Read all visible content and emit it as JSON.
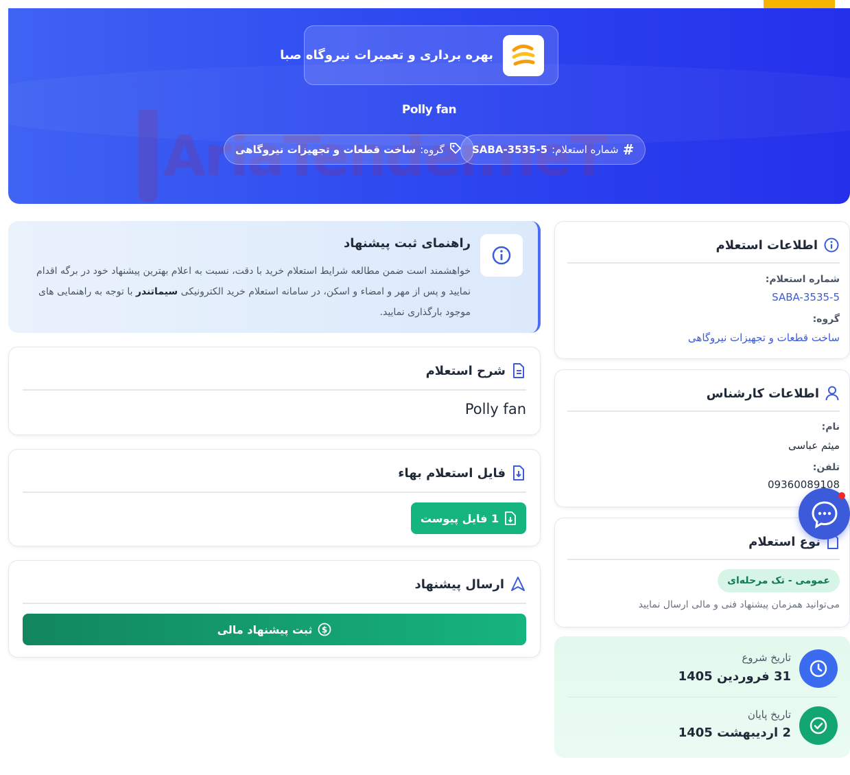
{
  "header": {
    "company_name": "بهره برداری و تعمیرات نیروگاه صبا",
    "title": "Polly fan",
    "inquiry_label": "شماره استعلام:",
    "inquiry_number": "SABA-3535-5",
    "group_label": "گروه:",
    "group_value": "ساخت قطعات و تجهیزات نیروگاهی",
    "watermark_text": "AriaTender.neT"
  },
  "guide": {
    "title": "راهنمای ثبت پیشنهاد",
    "text_part1": "خواهشمند است ضمن مطالعه شرایط استعلام خرید با دقت، نسبت به اعلام بهترین پیشنهاد خود در برگه اقدام نمایید و پس از مهر و امضاء و اسکن، در سامانه استعلام خرید الکترونیکی",
    "text_bold": "سیماتندر",
    "text_part2": "با توجه به راهنمایی های موجود بارگذاری نمایید."
  },
  "description_card": {
    "title": "شرح استعلام",
    "content": "Polly fan"
  },
  "file_card": {
    "title": "فایل استعلام بهاء",
    "button_label": "1 فایل پیوست"
  },
  "submit_card": {
    "title": "ارسال پیشنهاد",
    "button_label": "ثبت پیشنهاد مالی"
  },
  "inquiry_info": {
    "title": "اطلاعات استعلام",
    "number_label": "شماره استعلام:",
    "number_value": "SABA-3535-5",
    "group_label": "گروه:",
    "group_value": "ساخت قطعات و تجهیزات نیروگاهی"
  },
  "expert_info": {
    "title": "اطلاعات کارشناس",
    "name_label": "نام:",
    "name_value": "میثم عباسی",
    "phone_label": "تلفن:",
    "phone_value": "09360089108"
  },
  "inquiry_type": {
    "title": "نوع استعلام",
    "badge": "عمومی - تک مرحله‌ای",
    "note": "می‌توانید همزمان پیشنهاد فنی و مالی ارسال نمایید"
  },
  "dates": {
    "start_label": "تاریخ شروع",
    "start_value": "31 فروردین 1405",
    "end_label": "تاریخ پایان",
    "end_value": "2 اردیبهشت 1405"
  },
  "colors": {
    "primary": "#3b5bdb",
    "hero_start": "#3f63f3",
    "hero_end": "#2530ea",
    "success": "#16b47e",
    "accent": "#f5b400"
  }
}
